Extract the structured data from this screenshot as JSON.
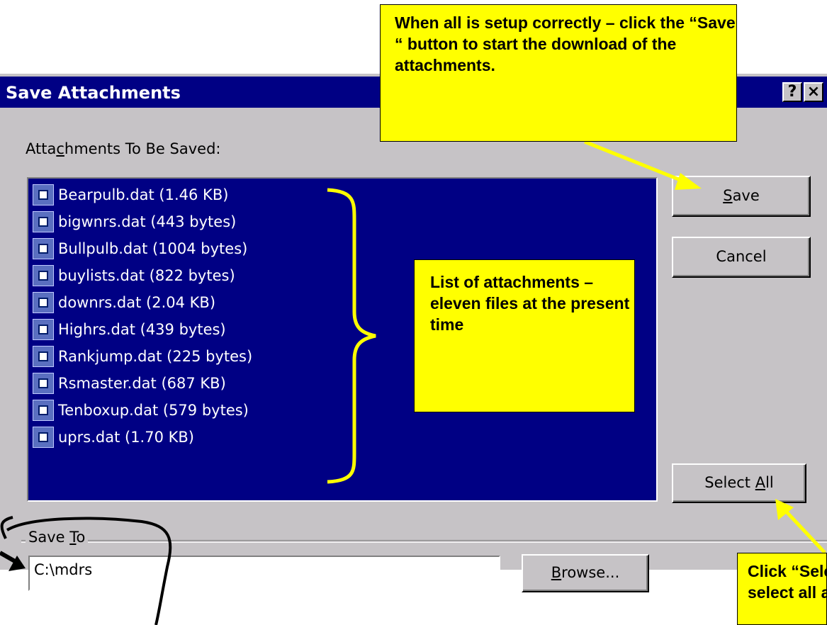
{
  "window": {
    "title": "Save Attachments",
    "help_button": "?",
    "close_button": "×"
  },
  "attachments_label": {
    "pre": "Atta",
    "accel": "c",
    "post": "hments To Be Saved:"
  },
  "attachments": [
    "Bearpulb.dat (1.46 KB)",
    "bigwnrs.dat (443 bytes)",
    "Bullpulb.dat (1004 bytes)",
    "buylists.dat (822 bytes)",
    "downrs.dat (2.04 KB)",
    "Highrs.dat (439 bytes)",
    "Rankjump.dat (225 bytes)",
    "Rsmaster.dat (687 KB)",
    "Tenboxup.dat (579 bytes)",
    "uprs.dat (1.70 KB)"
  ],
  "buttons": {
    "save": {
      "accel": "S",
      "rest": "ave"
    },
    "cancel": "Cancel",
    "select_all": {
      "pre": "Select ",
      "accel": "A",
      "post": "ll"
    },
    "browse": {
      "accel": "B",
      "rest": "rowse..."
    }
  },
  "save_to": {
    "label_pre": "Save ",
    "label_accel": "T",
    "label_post": "o",
    "value": "C:\\mdrs"
  },
  "callouts": {
    "save_note": "When all is setup correctly – click the “Save “ button to start the download of the attachments.",
    "list_note": "List of attachments – eleven files at the present time",
    "select_all_note": "Click “Select All” option to select all attachments"
  },
  "colors": {
    "titlebar": "#000084",
    "list_background": "#000084",
    "dialog_face": "#c6c3c6",
    "callout": "#ffff00",
    "arrow": "#ffff00"
  }
}
